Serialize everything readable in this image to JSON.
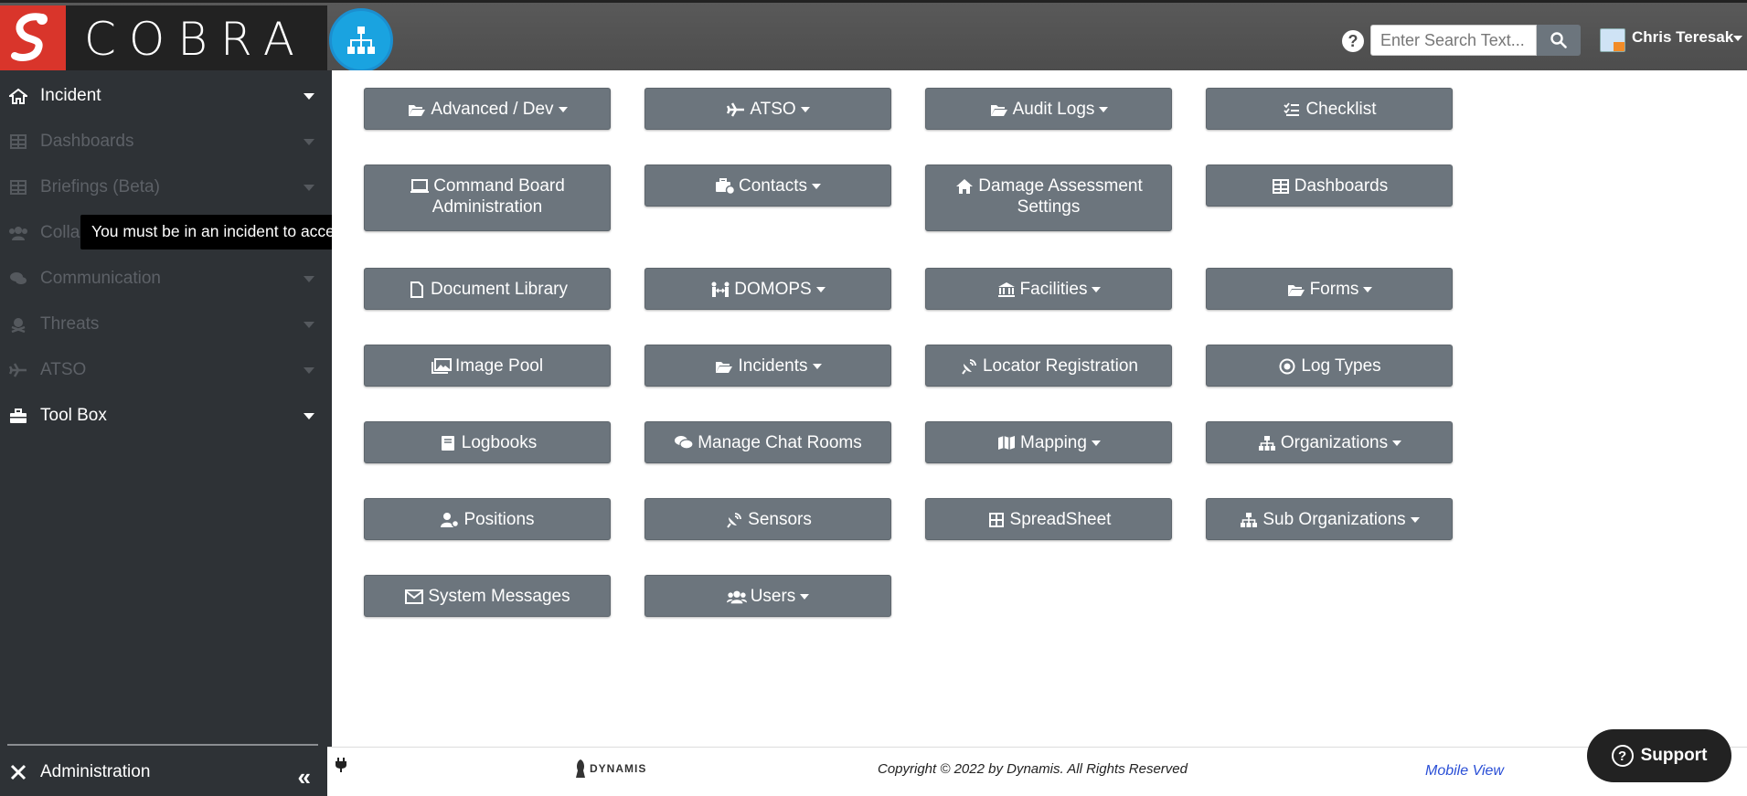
{
  "header": {
    "brand_name": "COBRA",
    "search_placeholder": "Enter Search Text...",
    "user_name": "Chris Teresak"
  },
  "sidebar": {
    "items": [
      {
        "label": "Incident",
        "state": "active",
        "icon": "home-icon"
      },
      {
        "label": "Dashboards",
        "state": "disabled",
        "icon": "table-icon"
      },
      {
        "label": "Briefings (Beta)",
        "state": "disabled",
        "icon": "table-icon"
      },
      {
        "label": "Colla",
        "state": "disabled",
        "icon": "users-icon"
      },
      {
        "label": "Communication",
        "state": "disabled",
        "icon": "comments-icon"
      },
      {
        "label": "Threats",
        "state": "disabled",
        "icon": "skull-crossbones-icon"
      },
      {
        "label": "ATSO",
        "state": "disabled",
        "icon": "plane-icon"
      },
      {
        "label": "Tool Box",
        "state": "active",
        "icon": "toolbox-icon"
      }
    ],
    "admin_label": "Administration",
    "tooltip": "You must be in an incident to access this feature"
  },
  "tiles": [
    {
      "label": "Advanced / Dev",
      "icon": "folder-open-icon",
      "dropdown": true
    },
    {
      "label": "ATSO",
      "icon": "plane-icon",
      "dropdown": true
    },
    {
      "label": "Audit Logs",
      "icon": "folder-open-icon",
      "dropdown": true
    },
    {
      "label": "Checklist",
      "icon": "tasks-icon",
      "dropdown": false
    },
    {
      "label": "Command Board Administration",
      "icon": "laptop-icon",
      "dropdown": false
    },
    {
      "label": "Contacts",
      "icon": "briefcase-clock-icon",
      "dropdown": true
    },
    {
      "label": "Damage Assessment Settings",
      "icon": "home-icon",
      "dropdown": false
    },
    {
      "label": "Dashboards",
      "icon": "table-icon",
      "dropdown": false
    },
    {
      "label": "Document Library",
      "icon": "file-icon",
      "dropdown": false
    },
    {
      "label": "DOMOPS",
      "icon": "people-arrows-icon",
      "dropdown": true
    },
    {
      "label": "Facilities",
      "icon": "landmark-icon",
      "dropdown": true
    },
    {
      "label": "Forms",
      "icon": "folder-open-icon",
      "dropdown": true
    },
    {
      "label": "Image Pool",
      "icon": "images-icon",
      "dropdown": false
    },
    {
      "label": "Incidents",
      "icon": "folder-open-icon",
      "dropdown": true
    },
    {
      "label": "Locator Registration",
      "icon": "satellite-dish-icon",
      "dropdown": false
    },
    {
      "label": "Log Types",
      "icon": "dot-circle-icon",
      "dropdown": false
    },
    {
      "label": "Logbooks",
      "icon": "book-icon",
      "dropdown": false
    },
    {
      "label": "Manage Chat Rooms",
      "icon": "comments-icon",
      "dropdown": false
    },
    {
      "label": "Mapping",
      "icon": "map-icon",
      "dropdown": true
    },
    {
      "label": "Organizations",
      "icon": "sitemap-icon",
      "dropdown": true
    },
    {
      "label": "Positions",
      "icon": "user-cog-icon",
      "dropdown": false
    },
    {
      "label": "Sensors",
      "icon": "satellite-dish-icon",
      "dropdown": false
    },
    {
      "label": "SpreadSheet",
      "icon": "th-icon",
      "dropdown": false
    },
    {
      "label": "Sub Organizations",
      "icon": "sitemap-icon",
      "dropdown": true
    },
    {
      "label": "System Messages",
      "icon": "envelope-icon",
      "dropdown": false
    },
    {
      "label": "Users",
      "icon": "users-icon",
      "dropdown": true
    }
  ],
  "footer": {
    "logo_text": "DYNAMIS",
    "copyright": "Copyright © 2022 by Dynamis. All Rights Reserved",
    "mobile_view": "Mobile View",
    "support": "Support"
  }
}
